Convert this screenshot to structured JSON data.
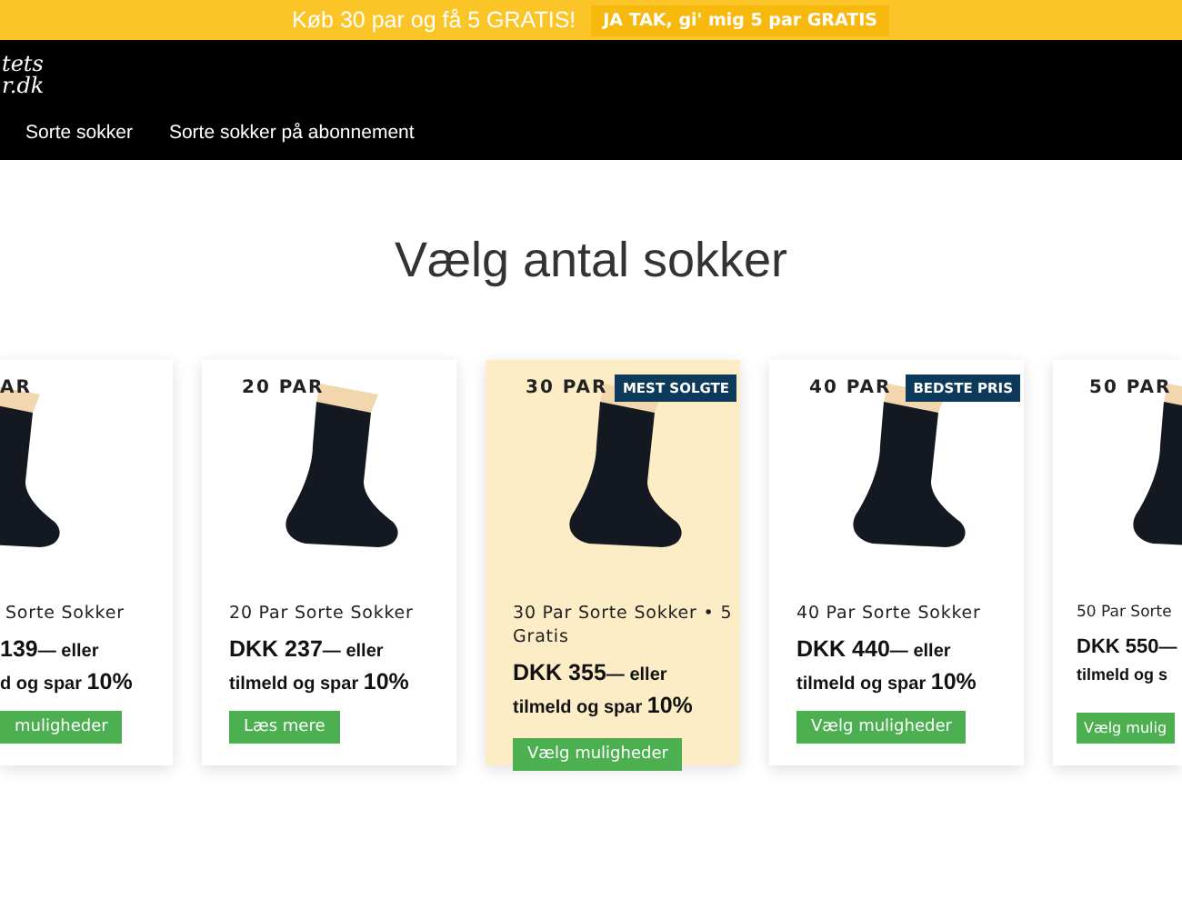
{
  "promo_bar": {
    "text": "Køb 30 par og få 5 GRATIS!",
    "button": "JA TAK, gi' mig 5 par GRATIS"
  },
  "header": {
    "logo_lines": [
      "tets",
      "r.dk"
    ],
    "nav": [
      "Sorte sokker",
      "Sorte sokker på abonnement"
    ]
  },
  "heading": "Vælg antal sokker",
  "products": [
    {
      "kind": "clipped-left",
      "highlighted": false,
      "quantity": "AR",
      "title": "Sorte Sokker",
      "price": "139",
      "price_suffix": "— eller",
      "subscribe_text": "d og spar",
      "discount": "10%",
      "button": "muligheder"
    },
    {
      "kind": "full",
      "highlighted": false,
      "quantity": "20 PAR",
      "title": "20 Par Sorte Sokker",
      "price": "DKK 237",
      "price_suffix": "— eller",
      "subscribe_text": "tilmeld og spar",
      "discount": "10%",
      "button": "Læs mere"
    },
    {
      "kind": "full",
      "highlighted": true,
      "quantity": "30 PAR",
      "badge": "MEST SOLGTE",
      "title": "30 Par Sorte Sokker • 5 Gratis",
      "price": "DKK 355",
      "price_suffix": "— eller",
      "subscribe_text": "tilmeld og spar",
      "discount": "10%",
      "button": "Vælg muligheder"
    },
    {
      "kind": "full",
      "highlighted": false,
      "quantity": "40 PAR",
      "badge": "BEDSTE PRIS",
      "title": "40 Par Sorte Sokker",
      "price": "DKK 440",
      "price_suffix": "— eller",
      "subscribe_text": "tilmeld og spar",
      "discount": "10%",
      "button": "Vælg muligheder"
    },
    {
      "kind": "clipped-right",
      "highlighted": false,
      "quantity": "50 PAR",
      "title": "50 Par Sorte",
      "price": "DKK 550",
      "price_suffix": "—",
      "subscribe_text": "tilmeld og s",
      "button": "Vælg mulig"
    }
  ]
}
